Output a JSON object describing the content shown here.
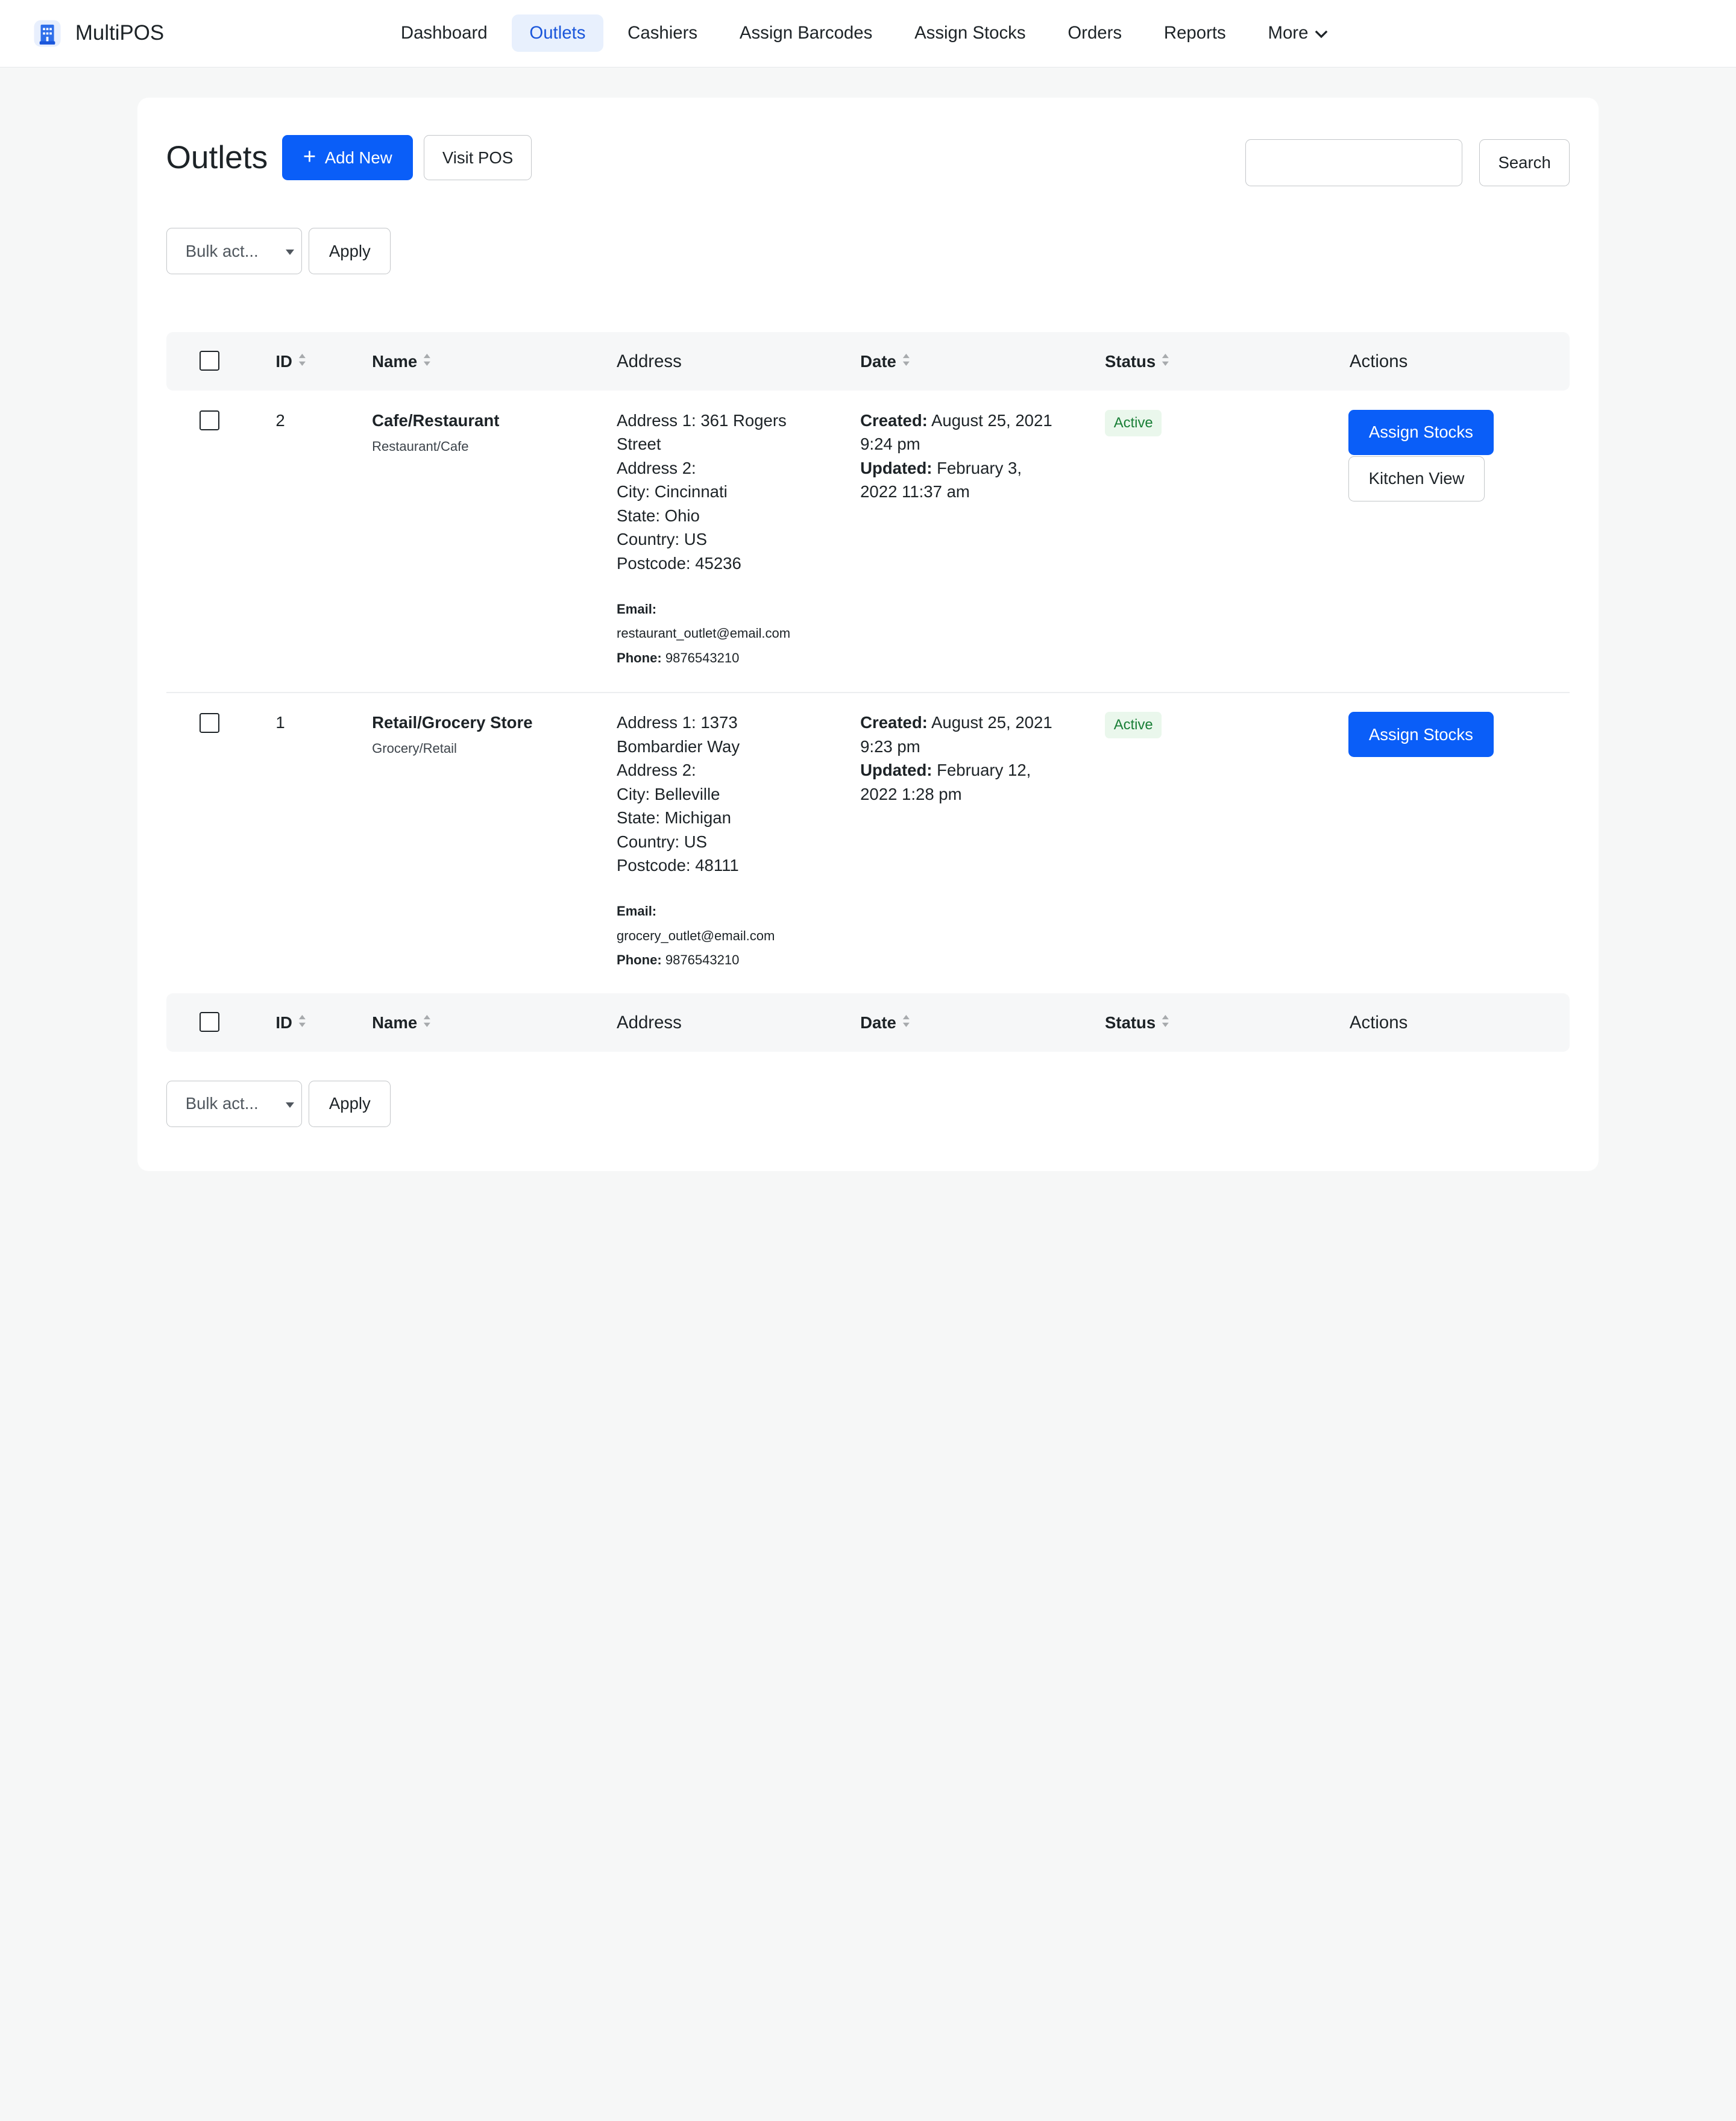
{
  "app": {
    "name": "MultiPOS"
  },
  "nav": {
    "items": [
      "Dashboard",
      "Outlets",
      "Cashiers",
      "Assign Barcodes",
      "Assign Stocks",
      "Orders",
      "Reports"
    ],
    "active": "Outlets",
    "more": "More"
  },
  "page": {
    "title": "Outlets",
    "add_new": "Add New",
    "visit_pos": "Visit POS",
    "search_value": "",
    "search_button": "Search",
    "bulk_select": "Bulk act...",
    "apply": "Apply"
  },
  "table": {
    "headers": {
      "id": "ID",
      "name": "Name",
      "address": "Address",
      "date": "Date",
      "status": "Status",
      "actions": "Actions"
    },
    "rows": [
      {
        "id": "2",
        "name": "Cafe/Restaurant",
        "type": "Restaurant/Cafe",
        "address_lines": [
          "Address 1: 361 Rogers",
          "Street",
          "Address 2:",
          "City: Cincinnati",
          "State: Ohio",
          "Country: US",
          "Postcode: 45236"
        ],
        "email_label": "Email:",
        "email": "restaurant_outlet@email.com",
        "phone_label": "Phone:",
        "phone": "9876543210",
        "created_label": "Created:",
        "created_1": "August 25, 2021",
        "created_2": "9:24 pm",
        "updated_label": "Updated:",
        "updated_1": "February 3,",
        "updated_2": "2022 11:37 am",
        "status": "Active",
        "actions": [
          "Assign Stocks",
          "Kitchen View"
        ]
      },
      {
        "id": "1",
        "name": "Retail/Grocery Store",
        "type": "Grocery/Retail",
        "address_lines": [
          "Address 1: 1373",
          "Bombardier Way",
          "Address 2:",
          "City: Belleville",
          "State: Michigan",
          "Country: US",
          "Postcode: 48111"
        ],
        "email_label": "Email:",
        "email": "grocery_outlet@email.com",
        "phone_label": "Phone:",
        "phone": "9876543210",
        "created_label": "Created:",
        "created_1": "August 25, 2021",
        "created_2": "9:23 pm",
        "updated_label": "Updated:",
        "updated_1": "February 12,",
        "updated_2": "2022 1:28 pm",
        "status": "Active",
        "actions": [
          "Assign Stocks"
        ]
      }
    ]
  },
  "colors": {
    "primary": "#0a5ef8",
    "active_nav_bg": "#e8f0fd",
    "active_badge_bg": "#eaf7ec",
    "active_badge_text": "#1a7f37"
  }
}
